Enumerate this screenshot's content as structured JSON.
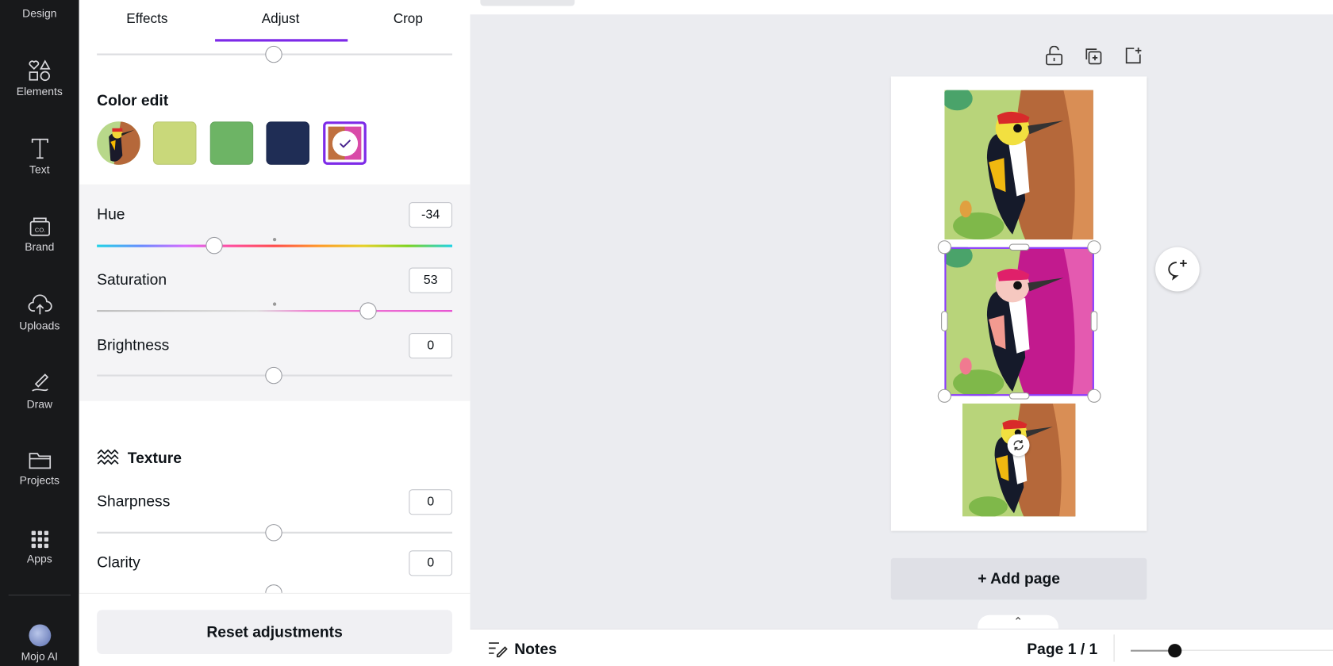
{
  "sidebar": {
    "items": [
      {
        "label": "Design",
        "icon": "layout-icon"
      },
      {
        "label": "Elements",
        "icon": "shapes-icon"
      },
      {
        "label": "Text",
        "icon": "text-icon"
      },
      {
        "label": "Brand",
        "icon": "brand-icon"
      },
      {
        "label": "Uploads",
        "icon": "upload-cloud-icon"
      },
      {
        "label": "Draw",
        "icon": "draw-icon"
      },
      {
        "label": "Projects",
        "icon": "folder-icon"
      },
      {
        "label": "Apps",
        "icon": "apps-grid-icon"
      },
      {
        "label": "Mojo AI",
        "icon": "avatar"
      }
    ]
  },
  "panel": {
    "tabs": [
      {
        "label": "Effects"
      },
      {
        "label": "Adjust",
        "active": true
      },
      {
        "label": "Crop"
      }
    ],
    "color_edit": {
      "title": "Color edit",
      "swatches": [
        "#c9d87a",
        "#6db465",
        "#1f2d55"
      ],
      "selected_swatch": [
        "#c0703f",
        "#d94aa8"
      ]
    },
    "hue": {
      "label": "Hue",
      "value": "-34",
      "position": -34
    },
    "saturation": {
      "label": "Saturation",
      "value": "53",
      "position": 53
    },
    "brightness": {
      "label": "Brightness",
      "value": "0",
      "position": 0
    },
    "texture": {
      "title": "Texture"
    },
    "sharpness": {
      "label": "Sharpness",
      "value": "0"
    },
    "clarity": {
      "label": "Clarity",
      "value": "0"
    },
    "reset_label": "Reset adjustments",
    "accent": "#7d2ae8"
  },
  "canvas": {
    "add_page_label": "+ Add page"
  },
  "bottombar": {
    "notes_label": "Notes",
    "page_label": "Page 1 / 1"
  }
}
